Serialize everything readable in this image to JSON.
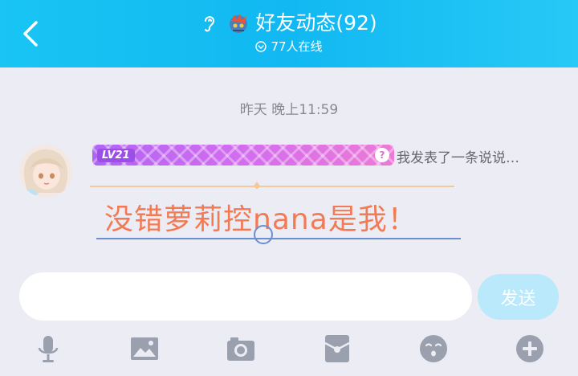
{
  "header": {
    "title": "好友动态(92)",
    "online": "77人在线"
  },
  "chat": {
    "timestamp": "昨天 晚上11:59",
    "message": {
      "level": "LV21",
      "help": "?",
      "action": "我发表了一条说说…",
      "text": "没错萝莉控nana是我！"
    }
  },
  "input": {
    "value": "",
    "placeholder": "",
    "send_label": "发送"
  },
  "toolbar": {
    "items": [
      "microphone-icon",
      "image-icon",
      "camera-icon",
      "red-packet-icon",
      "emoji-icon",
      "plus-icon"
    ]
  },
  "colors": {
    "header": "#11b8f2",
    "message_text": "#f27a55",
    "send_button": "#b9e9fb",
    "toolbar_icon": "#9aa0ad"
  }
}
